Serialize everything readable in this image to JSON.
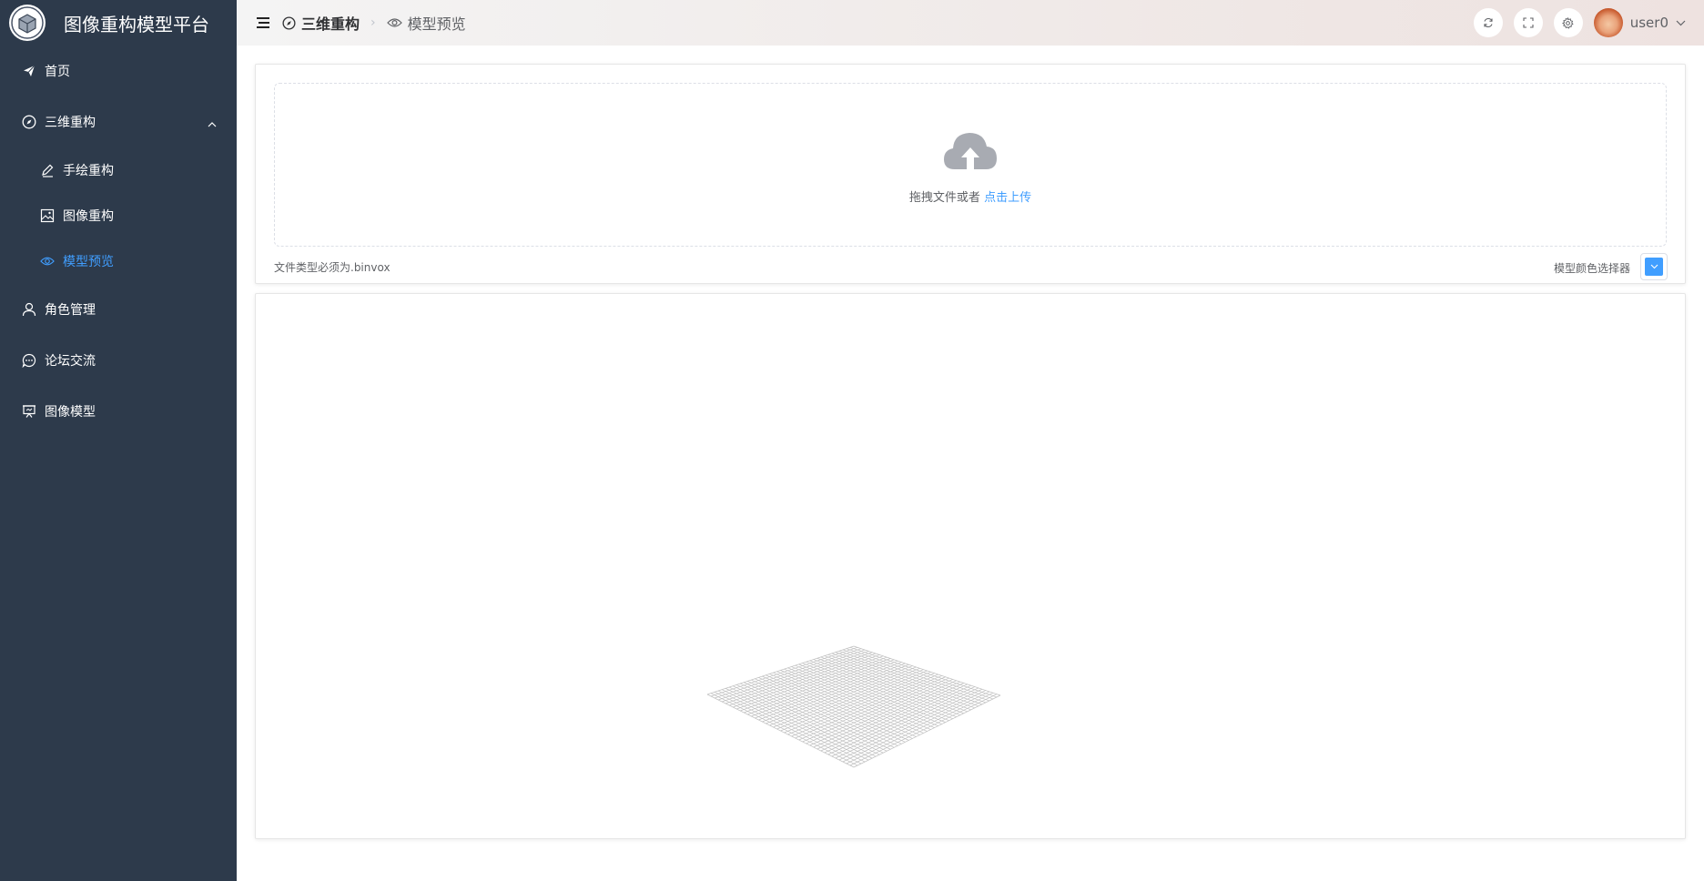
{
  "app": {
    "title": "图像重构模型平台"
  },
  "sidebar": {
    "items": [
      {
        "label": "首页",
        "icon": "send-icon"
      },
      {
        "label": "三维重构",
        "icon": "compass-icon",
        "expanded": true,
        "children": [
          {
            "label": "手绘重构",
            "icon": "pen-icon"
          },
          {
            "label": "图像重构",
            "icon": "picture-icon"
          },
          {
            "label": "模型预览",
            "icon": "eye-icon",
            "active": true
          }
        ]
      },
      {
        "label": "角色管理",
        "icon": "user-icon"
      },
      {
        "label": "论坛交流",
        "icon": "chat-icon"
      },
      {
        "label": "图像模型",
        "icon": "presentation-icon"
      }
    ]
  },
  "header": {
    "breadcrumb": [
      {
        "label": "三维重构",
        "icon": "compass-icon"
      },
      {
        "label": "模型预览",
        "icon": "eye-icon"
      }
    ],
    "username": "user0"
  },
  "upload": {
    "drag_text": "拖拽文件或者",
    "click_text": "点击上传",
    "tip": "文件类型必须为.binvox",
    "color_label": "模型颜色选择器",
    "color_value": "#409eff"
  },
  "colors": {
    "sidebar_bg": "#2d3a4b",
    "active": "#409eff",
    "grid": "#c0c0c0"
  }
}
